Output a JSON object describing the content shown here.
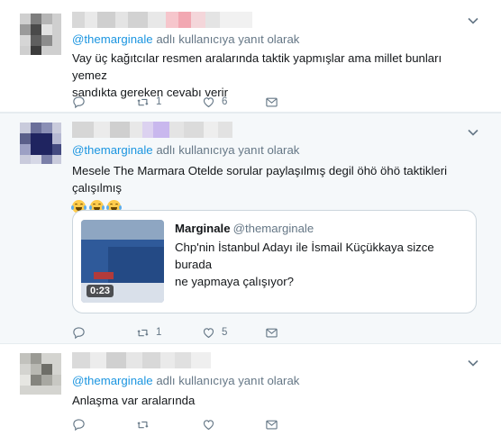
{
  "colors": {
    "link": "#1b95e0",
    "secondary_text": "#657786",
    "highlight_background": "#f5f8fa",
    "border": "#e6ecf0"
  },
  "tweets": [
    {
      "reply_prefix": "@themarginale",
      "reply_suffix": "adlı kullanıcıya yanıt olarak",
      "text_line1": "Vay üç kağıtcılar resmen aralarında taktik yapmışlar ama millet bunları yemez",
      "text_line2": "sandıkta gereken cevabı verir",
      "actions": {
        "reply_count": "",
        "retweet_count": "1",
        "like_count": "6"
      }
    },
    {
      "reply_prefix": "@themarginale",
      "reply_suffix": "adlı kullanıcıya yanıt olarak",
      "text_line1": "Mesele The Marmara Otelde sorular paylaşılmış degil öhö öhö taktikleri çalışılmış",
      "emojis": [
        "face-with-tears-of-joy",
        "face-with-tears-of-joy",
        "face-with-tears-of-joy"
      ],
      "quote": {
        "author_name": "Marginale",
        "author_handle": "@themarginale",
        "text_line1": "Chp'nin İstanbul Adayı ile İsmail Küçükkaya sizce burada",
        "text_line2": "ne yapmaya çalışıyor?",
        "video_duration": "0:23"
      },
      "actions": {
        "reply_count": "",
        "retweet_count": "1",
        "like_count": "5"
      }
    },
    {
      "reply_prefix": "@themarginale",
      "reply_suffix": "adlı kullanıcıya yanıt olarak",
      "text_line1": "Anlaşma var aralarında",
      "actions": {
        "reply_count": "",
        "retweet_count": "",
        "like_count": ""
      }
    }
  ],
  "icons": {
    "reply": "reply-icon",
    "retweet": "retweet-icon",
    "like": "heart-icon",
    "dm": "envelope-icon",
    "more": "chevron-down-icon"
  }
}
